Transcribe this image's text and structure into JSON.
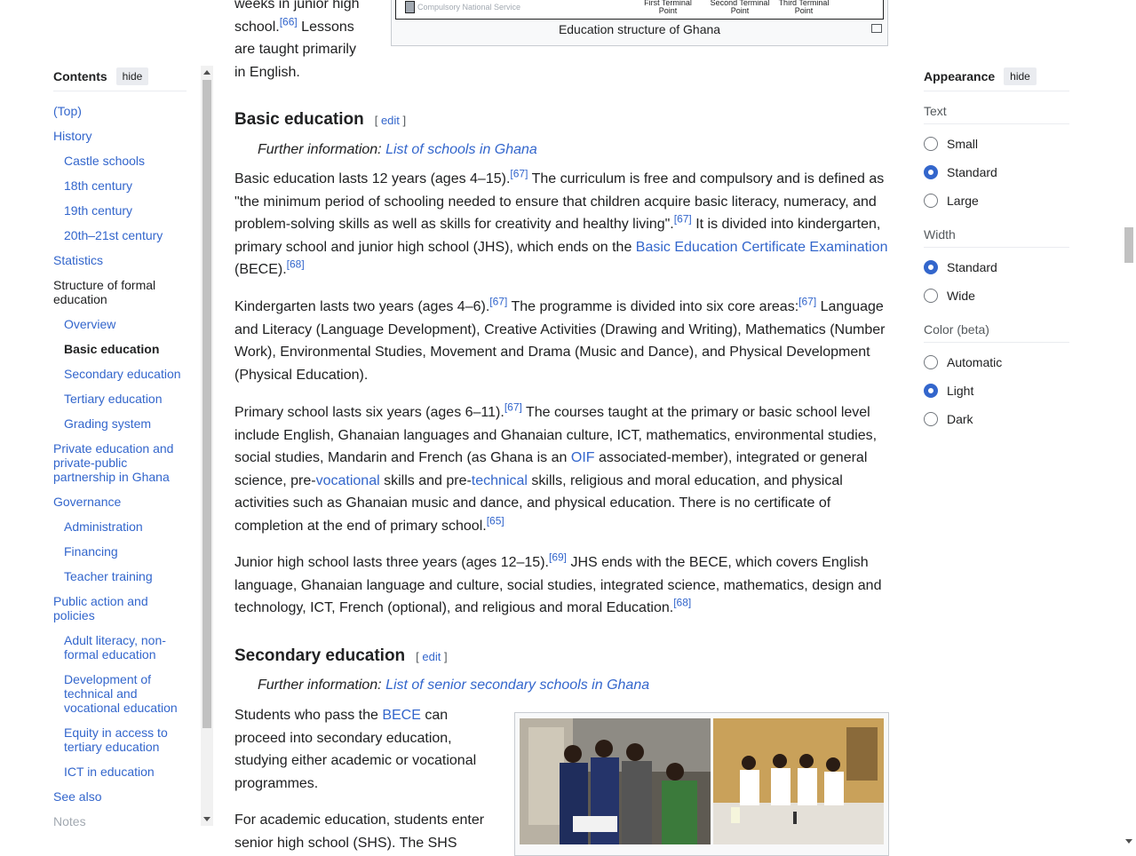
{
  "toc": {
    "title": "Contents",
    "hide_label": "hide",
    "items": [
      {
        "label": "(Top)",
        "level": 1
      },
      {
        "label": "History",
        "level": 1,
        "toggle": true
      },
      {
        "label": "Castle schools",
        "level": 2
      },
      {
        "label": "18th century",
        "level": 2
      },
      {
        "label": "19th century",
        "level": 2
      },
      {
        "label": "20th–21st century",
        "level": 2
      },
      {
        "label": "Statistics",
        "level": 1
      },
      {
        "label": "Structure of formal education",
        "level": 1,
        "toggle": true,
        "plain": true
      },
      {
        "label": "Overview",
        "level": 2
      },
      {
        "label": "Basic education",
        "level": 2,
        "active": true
      },
      {
        "label": "Secondary education",
        "level": 2
      },
      {
        "label": "Tertiary education",
        "level": 2
      },
      {
        "label": "Grading system",
        "level": 2
      },
      {
        "label": "Private education and private-public partnership in Ghana",
        "level": 1
      },
      {
        "label": "Governance",
        "level": 1,
        "toggle": true
      },
      {
        "label": "Administration",
        "level": 2
      },
      {
        "label": "Financing",
        "level": 2
      },
      {
        "label": "Teacher training",
        "level": 2
      },
      {
        "label": "Public action and policies",
        "level": 1,
        "toggle": true
      },
      {
        "label": "Adult literacy, non-formal education",
        "level": 2
      },
      {
        "label": "Development of technical and vocational education",
        "level": 2
      },
      {
        "label": "Equity in access to tertiary education",
        "level": 2
      },
      {
        "label": "ICT in education",
        "level": 2
      },
      {
        "label": "See also",
        "level": 1
      },
      {
        "label": "Notes",
        "level": 1,
        "faded": true
      }
    ]
  },
  "article": {
    "intro": {
      "line1": "weeks in junior high",
      "line2a": "school.",
      "ref66": "[66]",
      "line2b": " Lessons",
      "line3": "are taught primarily",
      "line4": "in English."
    },
    "figure_top": {
      "cns_label": "Compulsory National Service",
      "tp1": "First Terminal Point",
      "tp2": "Second Terminal Point",
      "tp3": "Third Terminal Point",
      "caption": "Education structure of Ghana"
    },
    "basic": {
      "heading": "Basic education",
      "edit": "edit",
      "further_prefix": "Further information: ",
      "further_link": "List of schools in Ghana",
      "p1": {
        "a": "Basic education lasts 12 years (ages 4–15).",
        "r1": "[67]",
        "b": " The curriculum is free and compulsory and is defined as \"the minimum period of schooling needed to ensure that children acquire basic literacy, numeracy, and problem-solving skills as well as skills for creativity and healthy living\".",
        "r2": "[67]",
        "c": " It is divided into kindergarten, primary school and junior high school (JHS), which ends on the ",
        "link": "Basic Education Certificate Examination",
        "d": " (BECE).",
        "r3": "[68]"
      },
      "p2": {
        "a": "Kindergarten lasts two years (ages 4–6).",
        "r1": "[67]",
        "b": " The programme is divided into six core areas:",
        "r2": "[67]",
        "c": " Language and Literacy (Language Development), Creative Activities (Drawing and Writing), Mathematics (Number Work), Environmental Studies, Movement and Drama (Music and Dance), and Physical Development (Physical Education)."
      },
      "p3": {
        "a": "Primary school lasts six years (ages 6–11).",
        "r1": "[67]",
        "b": " The courses taught at the primary or basic school level include English, Ghanaian languages and Ghanaian culture, ICT, mathematics, environmental studies, social studies, Mandarin and French (as Ghana is an ",
        "link1": "OIF",
        "c": " associated-member), integrated or general science, pre-",
        "link2": "vocational",
        "d": " skills and pre-",
        "link3": "technical",
        "e": " skills, religious and moral education, and physical activities such as Ghanaian music and dance, and physical education. There is no certificate of completion at the end of primary school.",
        "r2": "[65]"
      },
      "p4": {
        "a": "Junior high school lasts three years (ages 12–15).",
        "r1": "[69]",
        "b": " JHS ends with the BECE, which covers English language, Ghanaian language and culture, social studies, integrated science, mathematics, design and technology, ICT, French (optional), and religious and moral Education.",
        "r2": "[68]"
      }
    },
    "secondary": {
      "heading": "Secondary education",
      "edit": "edit",
      "further_prefix": "Further information: ",
      "further_link": "List of senior secondary schools in Ghana",
      "p1a": "Students who pass the ",
      "p1link": "BECE",
      "p1b": " can proceed into secondary education, studying either academic or vocational programmes.",
      "p2": "For academic education, students enter senior high school (SHS). The SHS"
    }
  },
  "appearance": {
    "title": "Appearance",
    "hide_label": "hide",
    "groups": [
      {
        "title": "Text",
        "options": [
          {
            "label": "Small",
            "on": false
          },
          {
            "label": "Standard",
            "on": true
          },
          {
            "label": "Large",
            "on": false
          }
        ]
      },
      {
        "title": "Width",
        "options": [
          {
            "label": "Standard",
            "on": true
          },
          {
            "label": "Wide",
            "on": false
          }
        ]
      },
      {
        "title": "Color (beta)",
        "options": [
          {
            "label": "Automatic",
            "on": false
          },
          {
            "label": "Light",
            "on": true
          },
          {
            "label": "Dark",
            "on": false
          }
        ]
      }
    ]
  },
  "colors": {
    "link": "#3366cc",
    "text": "#202122",
    "radio_on": "#3366cc"
  }
}
